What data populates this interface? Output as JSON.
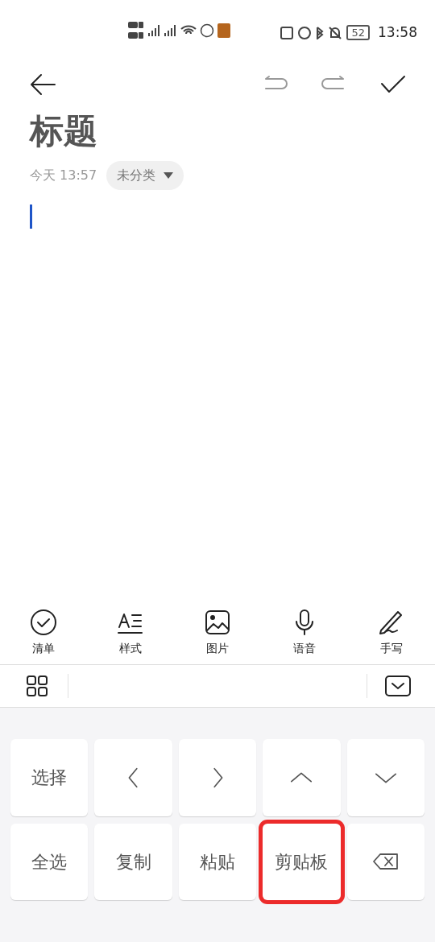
{
  "status_bar": {
    "battery": "52",
    "time": "13:58"
  },
  "title": "标题",
  "meta": {
    "date": "今天 13:57",
    "category": "未分类"
  },
  "tools": [
    {
      "kind": "checklist",
      "label": "清单"
    },
    {
      "kind": "style",
      "label": "样式"
    },
    {
      "kind": "image",
      "label": "图片"
    },
    {
      "kind": "voice",
      "label": "语音"
    },
    {
      "kind": "handwriting",
      "label": "手写"
    }
  ],
  "keys": [
    {
      "kind": "text",
      "label": "选择",
      "highlighted": false
    },
    {
      "kind": "left",
      "highlighted": false
    },
    {
      "kind": "right",
      "highlighted": false
    },
    {
      "kind": "up",
      "highlighted": false
    },
    {
      "kind": "down",
      "highlighted": false
    },
    {
      "kind": "text",
      "label": "全选",
      "highlighted": false
    },
    {
      "kind": "text",
      "label": "复制",
      "highlighted": false
    },
    {
      "kind": "text",
      "label": "粘贴",
      "highlighted": false
    },
    {
      "kind": "text",
      "label": "剪贴板",
      "highlighted": true
    },
    {
      "kind": "backspace",
      "highlighted": false
    }
  ]
}
